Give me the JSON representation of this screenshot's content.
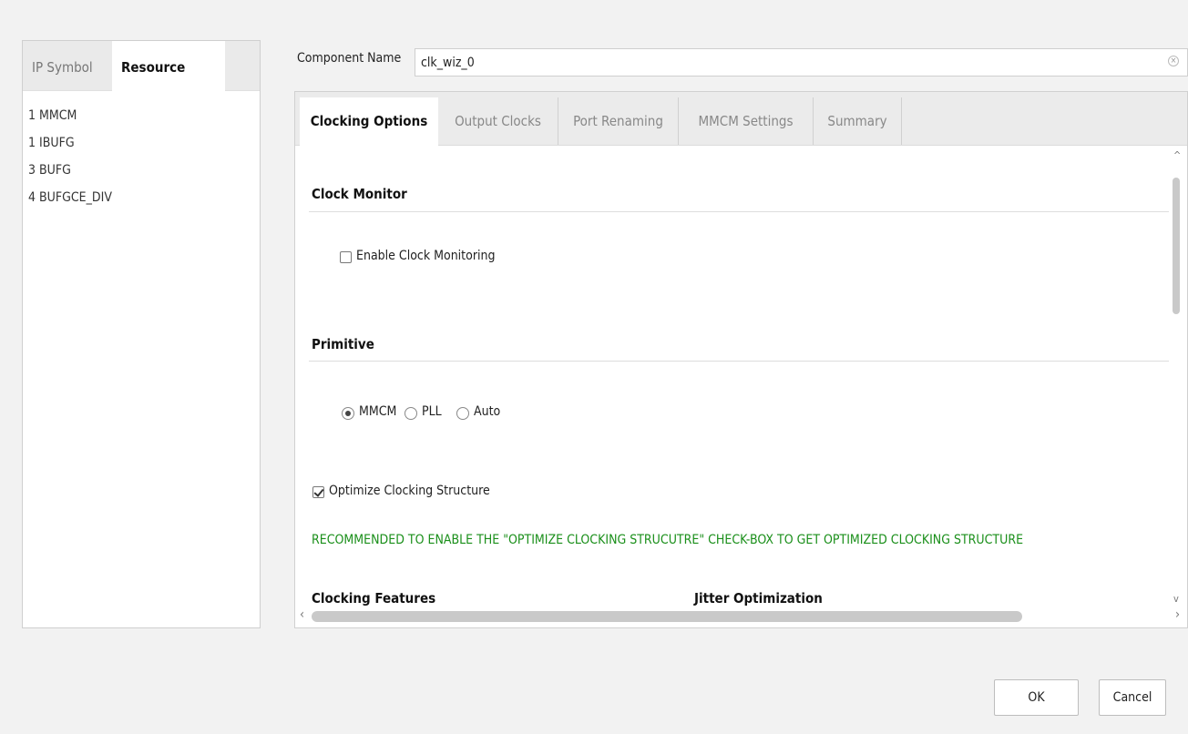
{
  "left_panel": {
    "tabs": [
      {
        "label": "IP Symbol",
        "active": false
      },
      {
        "label": "Resource",
        "active": true
      }
    ],
    "resources": [
      "1 MMCM",
      "1 IBUFG",
      "3 BUFG",
      "4 BUFGCE_DIV"
    ]
  },
  "component": {
    "label": "Component Name",
    "value": "clk_wiz_0"
  },
  "tabs": [
    {
      "label": "Clocking Options",
      "active": true
    },
    {
      "label": "Output Clocks",
      "active": false
    },
    {
      "label": "Port Renaming",
      "active": false
    },
    {
      "label": "MMCM Settings",
      "active": false
    },
    {
      "label": "Summary",
      "active": false
    }
  ],
  "clock_monitor": {
    "title": "Clock Monitor",
    "enable_label": "Enable Clock Monitoring",
    "enable_checked": false
  },
  "primitive": {
    "title": "Primitive",
    "options": [
      "MMCM",
      "PLL",
      "Auto"
    ],
    "selected": "MMCM"
  },
  "optimize": {
    "label": "Optimize Clocking Structure",
    "checked": true
  },
  "recommendation": "RECOMMENDED TO ENABLE THE \"OPTIMIZE CLOCKING STRUCUTRE\" CHECK-BOX TO GET OPTIMIZED CLOCKING STRUCTURE",
  "sections_below": {
    "clocking_features": "Clocking Features",
    "jitter_optimization": "Jitter Optimization"
  },
  "buttons": {
    "ok": "OK",
    "cancel": "Cancel"
  },
  "colors": {
    "recommend_text": "#1a8f1a",
    "background": "#f2f2f2"
  }
}
